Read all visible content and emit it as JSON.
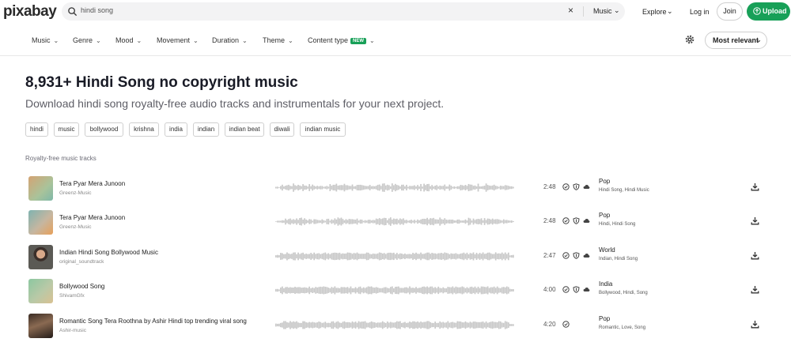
{
  "header": {
    "logo": "pixabay",
    "search_value": "hindi song",
    "search_scope": "Music",
    "explore_label": "Explore",
    "login_label": "Log in",
    "join_label": "Join",
    "upload_label": "Upload"
  },
  "filters": {
    "items": [
      {
        "label": "Music"
      },
      {
        "label": "Genre"
      },
      {
        "label": "Mood"
      },
      {
        "label": "Movement"
      },
      {
        "label": "Duration"
      },
      {
        "label": "Theme"
      },
      {
        "label": "Content type"
      }
    ],
    "new_badge": "NEW",
    "sort_label": "Most relevant"
  },
  "page": {
    "title": "8,931+ Hindi Song no copyright music",
    "subtitle": "Download hindi song royalty-free audio tracks and instrumentals for your next project.",
    "tags": [
      "hindi",
      "music",
      "bollywood",
      "krishna",
      "india",
      "indian",
      "indian beat",
      "diwali",
      "indian music"
    ],
    "section_label": "Royalty-free music tracks"
  },
  "tracks": [
    {
      "title": "Tera Pyar Mera Junoon",
      "artist": "Greenz-Music",
      "duration": "2:48",
      "genre": "Pop",
      "tags": "Hindi Song, Hindi Music"
    },
    {
      "title": "Tera Pyar Mera Junoon",
      "artist": "Greenz-Music",
      "duration": "2:48",
      "genre": "Pop",
      "tags": "Hindi, Hindi Song"
    },
    {
      "title": "Indian Hindi Song Bollywood Music",
      "artist": "original_soundtrack",
      "duration": "2:47",
      "genre": "World",
      "tags": "Indian, Hindi Song"
    },
    {
      "title": "Bollywood Song",
      "artist": "ShivamGfx",
      "duration": "4:00",
      "genre": "India",
      "tags": "Bollywood, Hindi, Song"
    },
    {
      "title": "Romantic Song Tera Roothna by Ashir Hindi top trending viral song",
      "artist": "Ashir-music",
      "duration": "4:20",
      "genre": "Pop",
      "tags": "Romantic, Love, Song"
    }
  ],
  "colors": {
    "accent": "#18a058",
    "text": "#191b26",
    "muted": "#5e5e66",
    "wave": "#c8c8c8"
  }
}
